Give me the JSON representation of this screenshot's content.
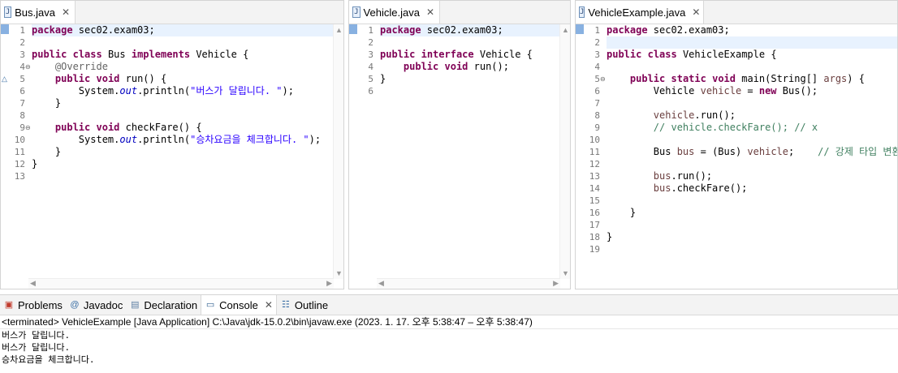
{
  "editors": [
    {
      "tab": "Bus.java",
      "lines": [
        [
          [
            "kw",
            "package"
          ],
          [
            "n",
            " sec02.exam03;"
          ]
        ],
        [],
        [
          [
            "kw",
            "public"
          ],
          [
            "n",
            " "
          ],
          [
            "kw",
            "class"
          ],
          [
            "n",
            " Bus "
          ],
          [
            "kw",
            "implements"
          ],
          [
            "n",
            " Vehicle {"
          ]
        ],
        [
          [
            "n",
            "    "
          ],
          [
            "ann",
            "@Override"
          ]
        ],
        [
          [
            "n",
            "    "
          ],
          [
            "kw",
            "public"
          ],
          [
            "n",
            " "
          ],
          [
            "kw",
            "void"
          ],
          [
            "n",
            " run() {"
          ]
        ],
        [
          [
            "n",
            "        System."
          ],
          [
            "fld",
            "out"
          ],
          [
            "n",
            ".println("
          ],
          [
            "str",
            "\"버스가 달립니다. \""
          ],
          [
            "n",
            ");"
          ]
        ],
        [
          [
            "n",
            "    }"
          ]
        ],
        [],
        [
          [
            "n",
            "    "
          ],
          [
            "kw",
            "public"
          ],
          [
            "n",
            " "
          ],
          [
            "kw",
            "void"
          ],
          [
            "n",
            " checkFare() {"
          ]
        ],
        [
          [
            "n",
            "        System."
          ],
          [
            "fld",
            "out"
          ],
          [
            "n",
            ".println("
          ],
          [
            "str",
            "\"승차요금을 체크합니다. \""
          ],
          [
            "n",
            ");"
          ]
        ],
        [
          [
            "n",
            "    }"
          ]
        ],
        [
          [
            "n",
            "}"
          ]
        ],
        []
      ]
    },
    {
      "tab": "Vehicle.java",
      "lines": [
        [
          [
            "kw",
            "package"
          ],
          [
            "n",
            " sec02.exam03;"
          ]
        ],
        [],
        [
          [
            "kw",
            "public"
          ],
          [
            "n",
            " "
          ],
          [
            "kw",
            "interface"
          ],
          [
            "n",
            " Vehicle {"
          ]
        ],
        [
          [
            "n",
            "    "
          ],
          [
            "kw",
            "public"
          ],
          [
            "n",
            " "
          ],
          [
            "kw",
            "void"
          ],
          [
            "n",
            " run();"
          ]
        ],
        [
          [
            "n",
            "}"
          ]
        ],
        []
      ]
    },
    {
      "tab": "VehicleExample.java",
      "lines": [
        [
          [
            "kw",
            "package"
          ],
          [
            "n",
            " sec02.exam03;"
          ]
        ],
        [],
        [
          [
            "kw",
            "public"
          ],
          [
            "n",
            " "
          ],
          [
            "kw",
            "class"
          ],
          [
            "n",
            " VehicleExample {"
          ]
        ],
        [],
        [
          [
            "n",
            "    "
          ],
          [
            "kw",
            "public"
          ],
          [
            "n",
            " "
          ],
          [
            "kw",
            "static"
          ],
          [
            "n",
            " "
          ],
          [
            "kw",
            "void"
          ],
          [
            "n",
            " main(String[] "
          ],
          [
            "var",
            "args"
          ],
          [
            "n",
            ") {"
          ]
        ],
        [
          [
            "n",
            "        Vehicle "
          ],
          [
            "var",
            "vehicle"
          ],
          [
            "n",
            " = "
          ],
          [
            "kw",
            "new"
          ],
          [
            "n",
            " Bus();"
          ]
        ],
        [],
        [
          [
            "n",
            "        "
          ],
          [
            "var",
            "vehicle"
          ],
          [
            "n",
            ".run();"
          ]
        ],
        [
          [
            "n",
            "        "
          ],
          [
            "cm",
            "// vehicle.checkFare(); // x"
          ]
        ],
        [],
        [
          [
            "n",
            "        Bus "
          ],
          [
            "var",
            "bus"
          ],
          [
            "n",
            " = (Bus) "
          ],
          [
            "var",
            "vehicle"
          ],
          [
            "n",
            ";    "
          ],
          [
            "cm",
            "// 강제 타입 변환"
          ]
        ],
        [],
        [
          [
            "n",
            "        "
          ],
          [
            "var",
            "bus"
          ],
          [
            "n",
            ".run();"
          ]
        ],
        [
          [
            "n",
            "        "
          ],
          [
            "var",
            "bus"
          ],
          [
            "n",
            ".checkFare();"
          ]
        ],
        [],
        [
          [
            "n",
            "    }"
          ]
        ],
        [],
        [
          [
            "n",
            "}"
          ]
        ],
        []
      ]
    }
  ],
  "views": {
    "tabs": [
      "Problems",
      "Javadoc",
      "Declaration",
      "Console",
      "Outline"
    ],
    "active": "Console"
  },
  "console": {
    "terminated": "<terminated> VehicleExample [Java Application] C:\\Java\\jdk-15.0.2\\bin\\javaw.exe  (2023. 1. 17. 오후 5:38:47 – 오후 5:38:47)",
    "output": [
      "버스가 달립니다.",
      "버스가 달립니다.",
      "승차요금을 체크합니다."
    ]
  },
  "colors": {
    "keyword": "#7f0055",
    "string": "#2a00ff",
    "comment": "#3f7f5f",
    "annotation": "#646464",
    "field": "#0000c0",
    "local": "#6a3e3e"
  }
}
